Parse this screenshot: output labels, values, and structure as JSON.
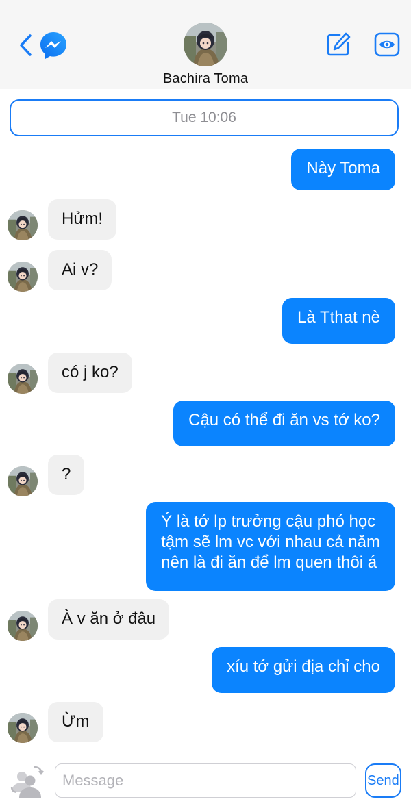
{
  "header": {
    "contact_name": "Bachira Toma"
  },
  "timestamp": "Tue 10:06",
  "messages": [
    {
      "side": "out",
      "text": "Này Toma"
    },
    {
      "side": "in",
      "text": "Hửm!"
    },
    {
      "side": "in",
      "text": "Ai v?"
    },
    {
      "side": "out",
      "text": "Là Tthat nè"
    },
    {
      "side": "in",
      "text": "có j ko?"
    },
    {
      "side": "out",
      "text": "Cậu có thể đi ăn vs tớ ko?"
    },
    {
      "side": "in",
      "text": "?"
    },
    {
      "side": "out",
      "text": "Ý là tớ lp trưởng cậu phó học\ntậm sẽ lm vc với nhau cả năm\nnên là đi ăn để lm quen thôi á"
    },
    {
      "side": "in",
      "text": "À v ăn ở đâu"
    },
    {
      "side": "out",
      "text": "xíu tớ gửi địa chỉ cho"
    },
    {
      "side": "in",
      "text": "Ừm"
    }
  ],
  "composer": {
    "placeholder": "Message",
    "value": "",
    "send_label": "Send"
  },
  "colors": {
    "accent": "#1a7cf6",
    "outgoing_bubble": "#0b84fe",
    "incoming_bubble": "#f0f0f0",
    "header_bg": "#f6f6f6"
  },
  "icons": [
    "back-chevron-icon",
    "messenger-icon",
    "compose-icon",
    "eye-icon",
    "contacts-swap-icon"
  ]
}
